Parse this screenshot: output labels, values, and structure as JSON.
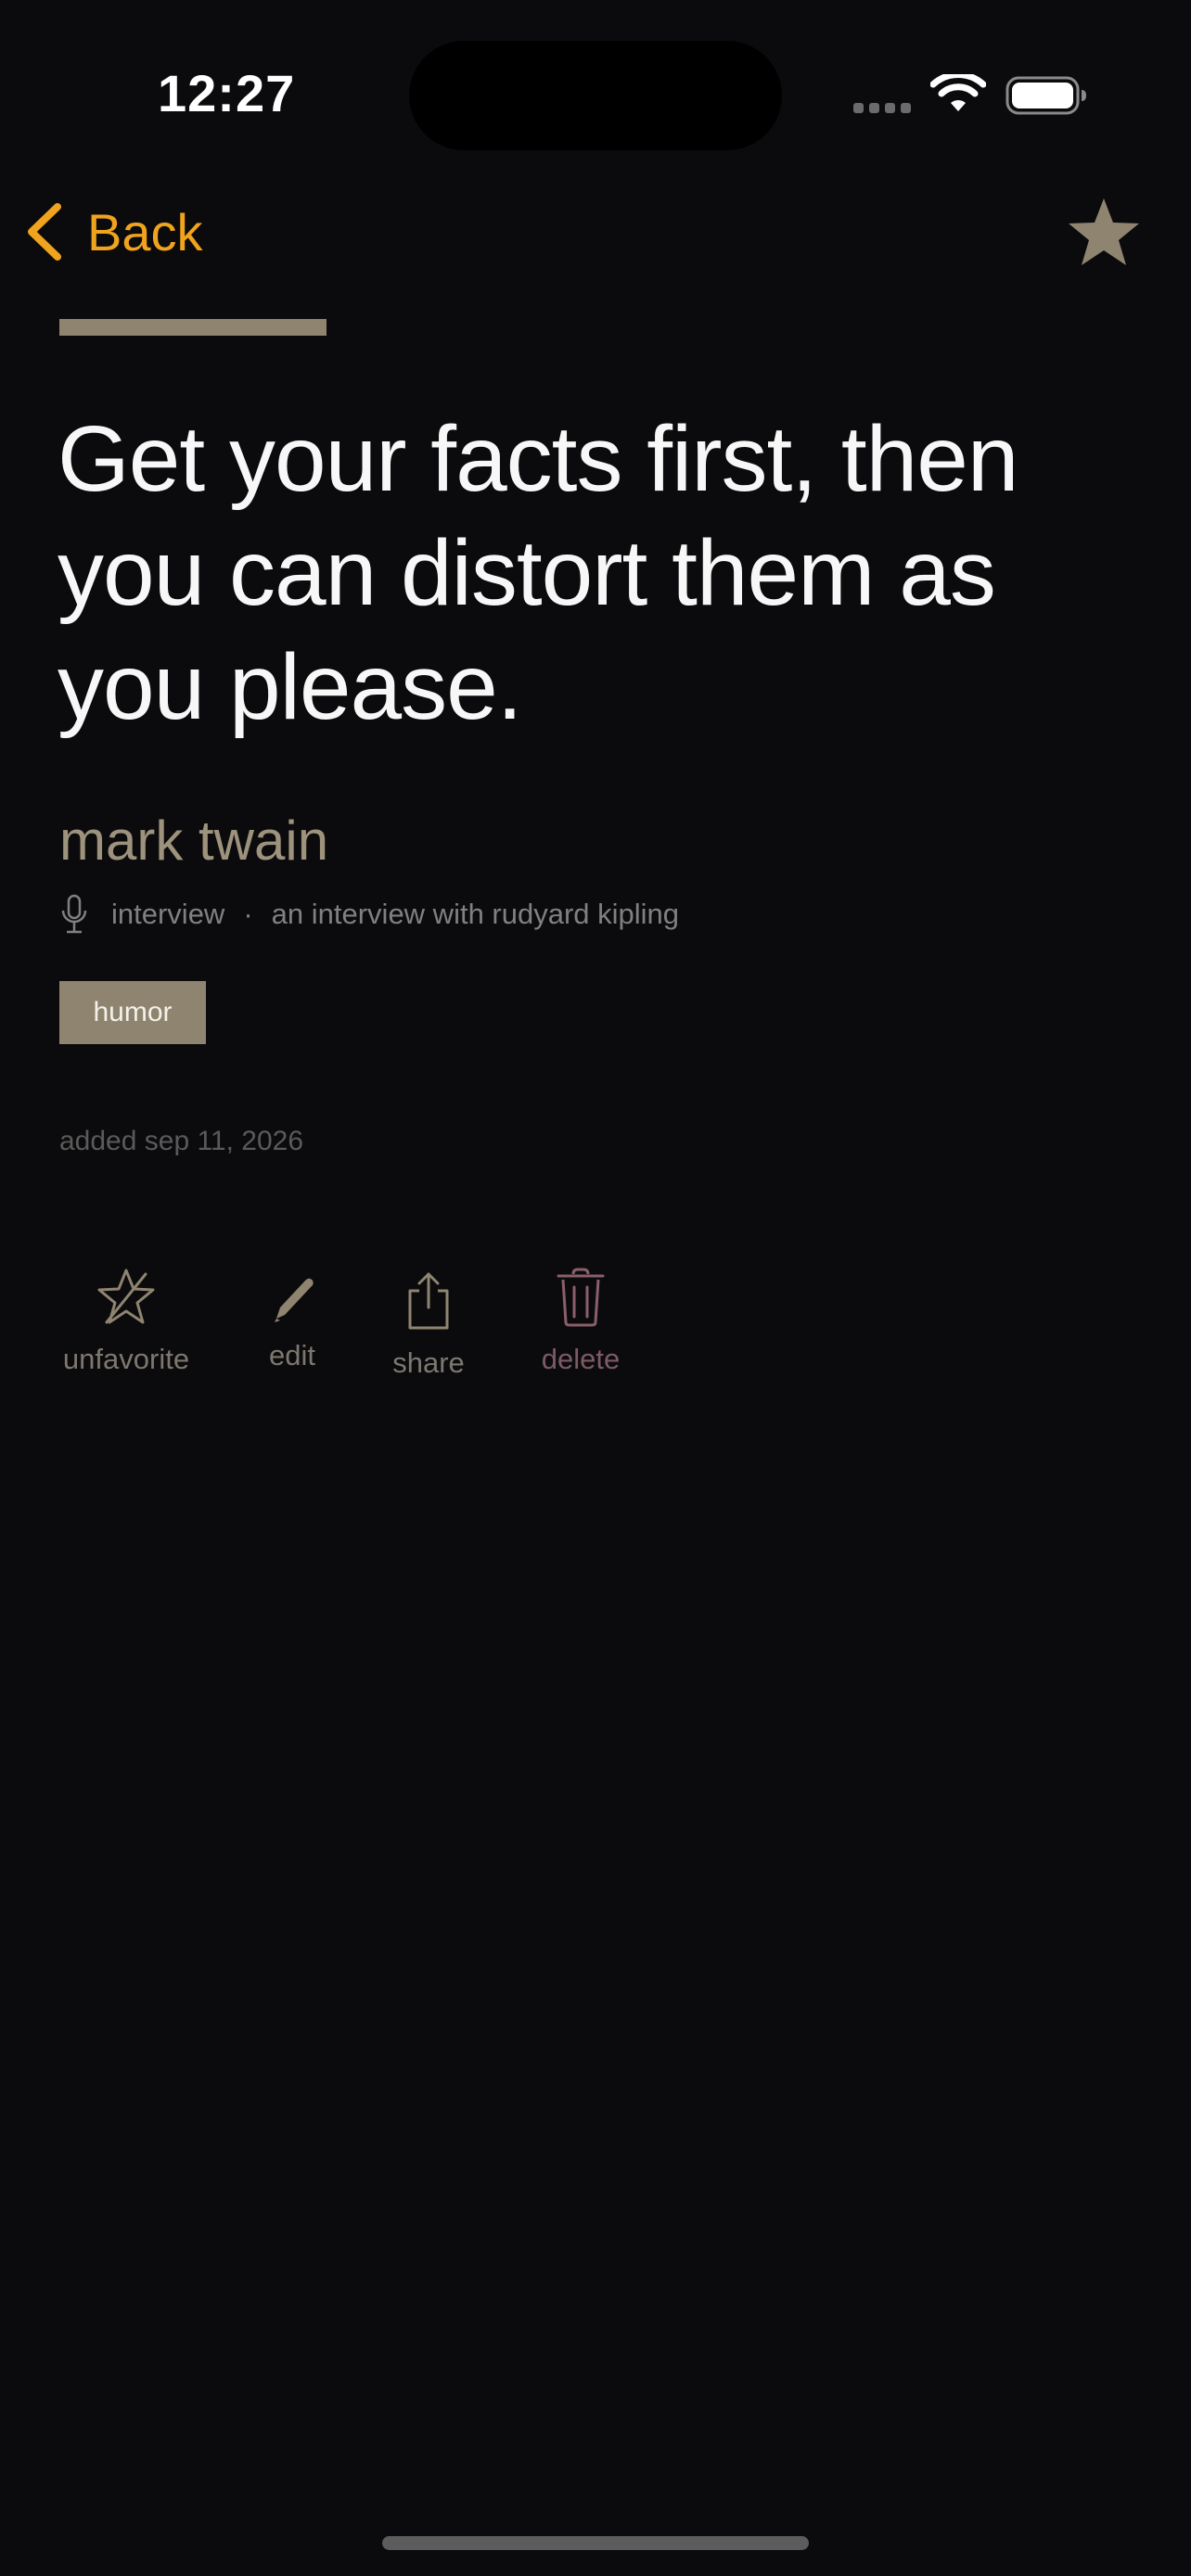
{
  "status_bar": {
    "time": "12:27",
    "icons": [
      "signal-dots-icon",
      "wifi-icon",
      "battery-icon"
    ]
  },
  "nav": {
    "back_label": "Back",
    "back_icon": "chevron-left-icon",
    "favorite_icon": "star-filled-icon"
  },
  "quote": {
    "text": "Get your facts first, then you can distort them as you please.",
    "author": "mark twain",
    "source_icon": "microphone-icon",
    "source_type": "interview",
    "separator": "·",
    "source_title": "an interview with rudyard kipling",
    "tags": [
      "humor"
    ],
    "added": "added sep 11, 2026"
  },
  "actions": {
    "unfavorite": {
      "label": "unfavorite",
      "icon": "star-slash-icon"
    },
    "edit": {
      "label": "edit",
      "icon": "pencil-icon"
    },
    "share": {
      "label": "share",
      "icon": "share-icon"
    },
    "delete": {
      "label": "delete",
      "icon": "trash-icon"
    }
  },
  "colors": {
    "background": "#0b0b0d",
    "accent_orange": "#f0a31c",
    "accent_tan": "#8f8470",
    "author": "#9d927c",
    "danger": "#7d5a64"
  }
}
